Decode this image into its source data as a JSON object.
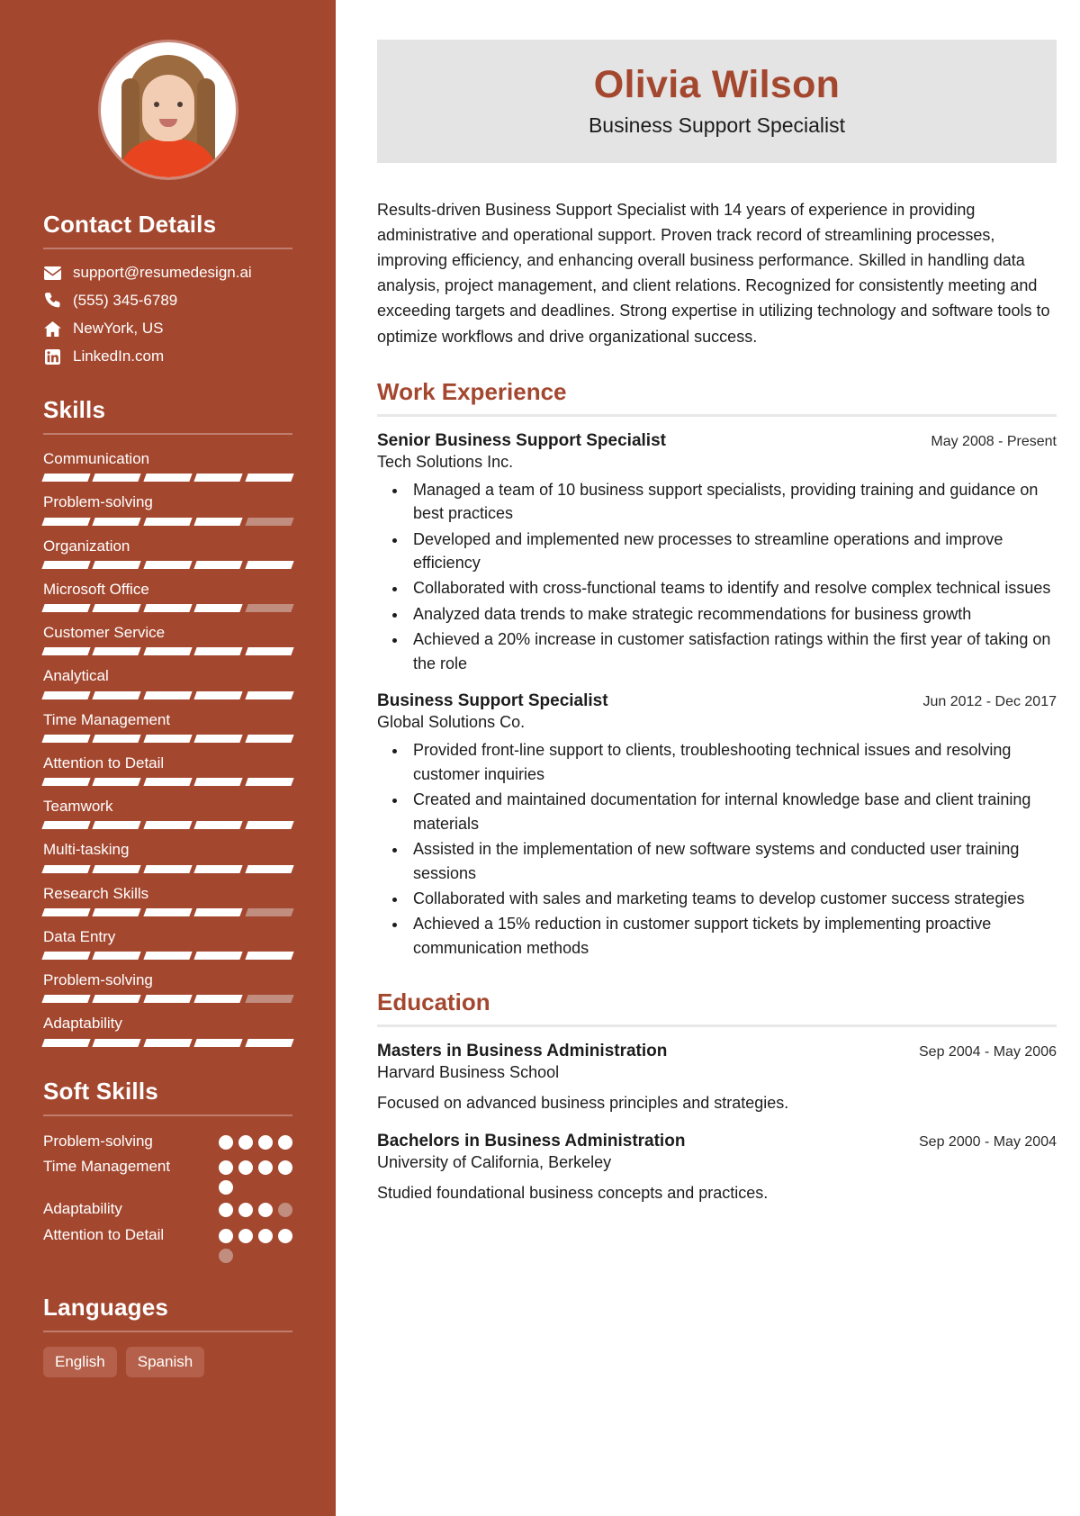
{
  "theme": {
    "sidebar_bg": "#a4472f",
    "accent": "#a4472f",
    "band_bg": "#e4e4e4",
    "bar_on": "#ffffff",
    "bar_off": "#c08d7e"
  },
  "sidebar": {
    "avatar_alt": "profile-photo",
    "contact": {
      "heading": "Contact Details",
      "items": [
        {
          "icon": "email-icon",
          "value": "support@resumedesign.ai"
        },
        {
          "icon": "phone-icon",
          "value": "(555) 345-6789"
        },
        {
          "icon": "home-icon",
          "value": "NewYork, US"
        },
        {
          "icon": "linkedin-icon",
          "value": "LinkedIn.com"
        }
      ]
    },
    "skills": {
      "heading": "Skills",
      "segments": 5,
      "items": [
        {
          "label": "Communication",
          "filled": 5
        },
        {
          "label": "Problem-solving",
          "filled": 4
        },
        {
          "label": "Organization",
          "filled": 5
        },
        {
          "label": "Microsoft Office",
          "filled": 4
        },
        {
          "label": "Customer Service",
          "filled": 5
        },
        {
          "label": "Analytical",
          "filled": 5
        },
        {
          "label": "Time Management",
          "filled": 5
        },
        {
          "label": "Attention to Detail",
          "filled": 5
        },
        {
          "label": "Teamwork",
          "filled": 5
        },
        {
          "label": "Multi-tasking",
          "filled": 5
        },
        {
          "label": "Research Skills",
          "filled": 4
        },
        {
          "label": "Data Entry",
          "filled": 5
        },
        {
          "label": "Problem-solving",
          "filled": 4
        },
        {
          "label": "Adaptability",
          "filled": 5
        }
      ]
    },
    "soft_skills": {
      "heading": "Soft Skills",
      "total": 4,
      "items": [
        {
          "label": "Problem-solving",
          "total": 4,
          "filled": 4
        },
        {
          "label": "Time Management",
          "total": 5,
          "filled": 5
        },
        {
          "label": "Adaptability",
          "total": 4,
          "filled": 3
        },
        {
          "label": "Attention to Detail",
          "total": 5,
          "filled": 4
        }
      ]
    },
    "languages": {
      "heading": "Languages",
      "items": [
        "English",
        "Spanish"
      ]
    }
  },
  "header": {
    "name": "Olivia Wilson",
    "role": "Business Support Specialist"
  },
  "summary": "Results-driven Business Support Specialist with 14 years of experience in providing administrative and operational support. Proven track record of streamlining processes, improving efficiency, and enhancing overall business performance. Skilled in handling data analysis, project management, and client relations. Recognized for consistently meeting and exceeding targets and deadlines. Strong expertise in utilizing technology and software tools to optimize workflows and drive organizational success.",
  "work": {
    "heading": "Work Experience",
    "entries": [
      {
        "title": "Senior Business Support Specialist",
        "org": "Tech Solutions Inc.",
        "date": "May 2008 - Present",
        "bullets": [
          "Managed a team of 10 business support specialists, providing training and guidance on best practices",
          "Developed and implemented new processes to streamline operations and improve efficiency",
          "Collaborated with cross-functional teams to identify and resolve complex technical issues",
          "Analyzed data trends to make strategic recommendations for business growth",
          "Achieved a 20% increase in customer satisfaction ratings within the first year of taking on the role"
        ]
      },
      {
        "title": "Business Support Specialist",
        "org": "Global Solutions Co.",
        "date": "Jun 2012 - Dec 2017",
        "bullets": [
          "Provided front-line support to clients, troubleshooting technical issues and resolving customer inquiries",
          "Created and maintained documentation for internal knowledge base and client training materials",
          "Assisted in the implementation of new software systems and conducted user training sessions",
          "Collaborated with sales and marketing teams to develop customer success strategies",
          "Achieved a 15% reduction in customer support tickets by implementing proactive communication methods"
        ]
      }
    ]
  },
  "education": {
    "heading": "Education",
    "entries": [
      {
        "title": "Masters in Business Administration",
        "org": "Harvard Business School",
        "date": "Sep 2004 - May 2006",
        "desc": "Focused on advanced business principles and strategies."
      },
      {
        "title": "Bachelors in Business Administration",
        "org": "University of California, Berkeley",
        "date": "Sep 2000 - May 2004",
        "desc": "Studied foundational business concepts and practices."
      }
    ]
  }
}
